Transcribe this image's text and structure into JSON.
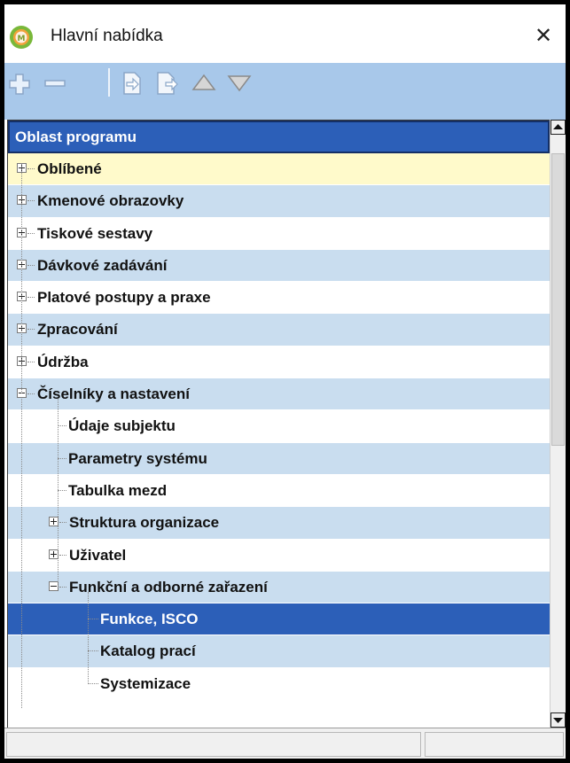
{
  "window": {
    "title": "Hlavní nabídka",
    "close_glyph": "✕",
    "app_icon": "app-logo-icon",
    "accent_color": "#2c5fb8"
  },
  "toolbar": {
    "buttons": [
      {
        "name": "expand-all-icon"
      },
      {
        "name": "collapse-all-icon"
      },
      {
        "name": "add-favorite-icon"
      },
      {
        "name": "remove-favorite-icon"
      },
      {
        "name": "move-up-icon"
      },
      {
        "name": "move-down-icon"
      }
    ]
  },
  "tree": {
    "header": "Oblast programu",
    "items": [
      {
        "label": "Oblíbené",
        "level": 0,
        "expander": "plus",
        "style": "yellow"
      },
      {
        "label": "Kmenové obrazovky",
        "level": 0,
        "expander": "plus",
        "style": "light"
      },
      {
        "label": "Tiskové sestavy",
        "level": 0,
        "expander": "plus",
        "style": "white"
      },
      {
        "label": "Dávkové zadávání",
        "level": 0,
        "expander": "plus",
        "style": "light"
      },
      {
        "label": "Platové postupy a praxe",
        "level": 0,
        "expander": "plus",
        "style": "white"
      },
      {
        "label": "Zpracování",
        "level": 0,
        "expander": "plus",
        "style": "light"
      },
      {
        "label": "Údržba",
        "level": 0,
        "expander": "plus",
        "style": "white"
      },
      {
        "label": "Číselníky a nastavení",
        "level": 0,
        "expander": "minus",
        "style": "light"
      },
      {
        "label": "Údaje subjektu",
        "level": 1,
        "expander": "none",
        "style": "white"
      },
      {
        "label": "Parametry systému",
        "level": 1,
        "expander": "none",
        "style": "light"
      },
      {
        "label": "Tabulka mezd",
        "level": 1,
        "expander": "none",
        "style": "white"
      },
      {
        "label": "Struktura organizace",
        "level": 1,
        "expander": "plus",
        "style": "light"
      },
      {
        "label": "Uživatel",
        "level": 1,
        "expander": "plus",
        "style": "white"
      },
      {
        "label": "Funkční a odborné zařazení",
        "level": 1,
        "expander": "minus",
        "style": "light"
      },
      {
        "label": "Funkce, ISCO",
        "level": 2,
        "expander": "none",
        "style": "selected"
      },
      {
        "label": "Katalog prací",
        "level": 2,
        "expander": "none",
        "style": "light"
      },
      {
        "label": "Systemizace",
        "level": 2,
        "expander": "none",
        "style": "white"
      }
    ]
  }
}
